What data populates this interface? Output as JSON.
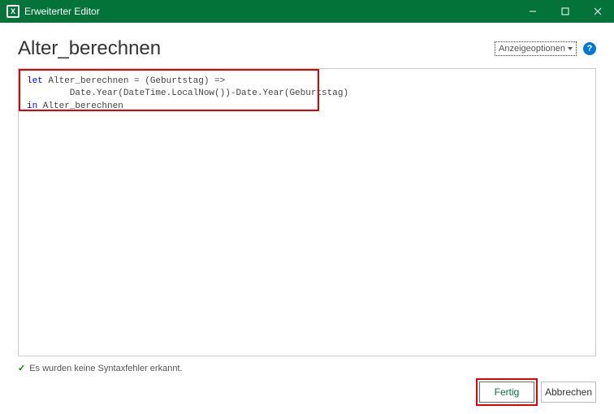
{
  "titlebar": {
    "app_icon_letter": "X",
    "title": "Erweiterter Editor"
  },
  "header": {
    "function_name": "Alter_berechnen",
    "options_label": "Anzeigeoptionen",
    "help_symbol": "?"
  },
  "code": {
    "kw_let": "let",
    "let_rest": " Alter_berechnen = (Geburtstag) =>",
    "body": "        Date.Year(DateTime.LocalNow())-Date.Year(Geburtstag)",
    "kw_in": "in",
    "in_rest": " Alter_berechnen"
  },
  "status": {
    "check": "✓",
    "text": "Es wurden keine Syntaxfehler erkannt."
  },
  "buttons": {
    "done": "Fertig",
    "cancel": "Abbrechen"
  }
}
